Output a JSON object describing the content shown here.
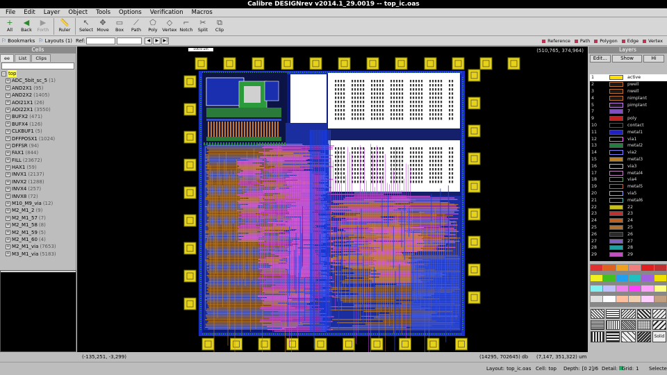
{
  "window": {
    "title": "Calibre DESIGNrev v2014.1_29.0019  --  top_ic.oas"
  },
  "menu": [
    "File",
    "Edit",
    "Layer",
    "Object",
    "Tools",
    "Options",
    "Verification",
    "Macros"
  ],
  "toolbar": [
    {
      "label": "All",
      "icon": "+",
      "name": "all"
    },
    {
      "label": "Back",
      "icon": "◀",
      "name": "back"
    },
    {
      "label": "Forth",
      "icon": "▶",
      "name": "forth",
      "disabled": true
    },
    {
      "label": "Ruler",
      "icon": "📏",
      "name": "ruler"
    },
    {
      "label": "Select",
      "icon": "↖",
      "name": "select"
    },
    {
      "label": "Move",
      "icon": "✥",
      "name": "move"
    },
    {
      "label": "Box",
      "icon": "▭",
      "name": "box"
    },
    {
      "label": "Path",
      "icon": "⟋",
      "name": "path"
    },
    {
      "label": "Poly",
      "icon": "⬠",
      "name": "poly"
    },
    {
      "label": "Vertex",
      "icon": "◇",
      "name": "vertex"
    },
    {
      "label": "Notch",
      "icon": "⌐",
      "name": "notch"
    },
    {
      "label": "Split",
      "icon": "✂",
      "name": "split"
    },
    {
      "label": "Clip",
      "icon": "⧉",
      "name": "clip"
    }
  ],
  "toolbar2": {
    "bookmarks": "Bookmarks",
    "layouts": "Layouts (1)",
    "ref": "Ref:",
    "filters": [
      "Reference",
      "Path",
      "Polygon",
      "Edge",
      "Vertex"
    ]
  },
  "cells": {
    "header": "Cells",
    "tabs": [
      "ee",
      "List",
      "Clips"
    ],
    "items": [
      {
        "name": "top",
        "count": "",
        "top": true
      },
      {
        "name": "ADC_5bit_sc_5",
        "count": "(1)"
      },
      {
        "name": "AND2X1",
        "count": "(95)"
      },
      {
        "name": "AND2X2",
        "count": "(1405)"
      },
      {
        "name": "AOI21X1",
        "count": "(26)"
      },
      {
        "name": "AOI22X1",
        "count": "(3550)"
      },
      {
        "name": "BUFX2",
        "count": "(471)"
      },
      {
        "name": "BUFX4",
        "count": "(126)"
      },
      {
        "name": "CLKBUF1",
        "count": "(5)"
      },
      {
        "name": "DFFPOSX1",
        "count": "(1024)"
      },
      {
        "name": "DFFSR",
        "count": "(94)"
      },
      {
        "name": "FAX1",
        "count": "(844)"
      },
      {
        "name": "FILL",
        "count": "(23672)"
      },
      {
        "name": "HAX1",
        "count": "(59)"
      },
      {
        "name": "INVX1",
        "count": "(2137)"
      },
      {
        "name": "INVX2",
        "count": "(1288)"
      },
      {
        "name": "INVX4",
        "count": "(257)"
      },
      {
        "name": "INVX8",
        "count": "(72)"
      },
      {
        "name": "M10_M9_via",
        "count": "(12)"
      },
      {
        "name": "M2_M1_2",
        "count": "(9)"
      },
      {
        "name": "M2_M1_57",
        "count": "(7)"
      },
      {
        "name": "M2_M1_58",
        "count": "(8)"
      },
      {
        "name": "M2_M1_59",
        "count": "(5)"
      },
      {
        "name": "M2_M1_60",
        "count": "(4)"
      },
      {
        "name": "M2_M1_via",
        "count": "(7653)"
      },
      {
        "name": "M3_M1_via",
        "count": "(5183)"
      }
    ]
  },
  "canvas": {
    "ruler": "100.0 um",
    "coord_tr": "(510,765, 374,964)"
  },
  "status": {
    "cursor": "(-135,251, -3,299)",
    "db": "(14295, 702645) db",
    "um": "(7,147, 351,322) um"
  },
  "bottom": {
    "layout_label": "Layout:",
    "layout": "top_ic.oas",
    "cell_label": "Cell:",
    "cell": "top",
    "depth_label": "Depth:",
    "depth": "[0 2]/6",
    "detail_label": "Detail:",
    "grid_label": "Grid:",
    "grid": "1",
    "selected_label": "Selected"
  },
  "layers": {
    "header": "Layers",
    "buttons": [
      "Edit...",
      "Show",
      "Hi"
    ],
    "items": [
      {
        "num": "1",
        "name": "active",
        "color": "#2a8a2a",
        "sel": true
      },
      {
        "num": "2",
        "name": "pwell",
        "color": "#1a1a1a",
        "border": "#c07030"
      },
      {
        "num": "3",
        "name": "nwell",
        "color": "#1a1a1a",
        "border": "#c07030"
      },
      {
        "num": "4",
        "name": "nimplant",
        "color": "#1a1a1a",
        "border": "#c07030"
      },
      {
        "num": "5",
        "name": "pimplant",
        "color": "#1a1a1a",
        "border": "#c080e0"
      },
      {
        "num": "7",
        "name": "7",
        "color": "#8050c0"
      },
      {
        "num": "9",
        "name": "poly",
        "color": "#c02020"
      },
      {
        "num": "10",
        "name": "contact",
        "color": "#000"
      },
      {
        "num": "11",
        "name": "metal1",
        "color": "#2020c0"
      },
      {
        "num": "12",
        "name": "via1",
        "color": "#000",
        "border": "#ff60ff"
      },
      {
        "num": "13",
        "name": "metal2",
        "color": "#208040"
      },
      {
        "num": "14",
        "name": "via2",
        "color": "#000",
        "border": "#8080ff"
      },
      {
        "num": "15",
        "name": "metal3",
        "color": "#c08020"
      },
      {
        "num": "16",
        "name": "via3",
        "color": "#000",
        "border": "#c0c0c0"
      },
      {
        "num": "17",
        "name": "metal4",
        "color": "#000",
        "border": "#c080c0"
      },
      {
        "num": "18",
        "name": "via4",
        "color": "#000",
        "border": "#60a060"
      },
      {
        "num": "19",
        "name": "metal5",
        "color": "#000",
        "border": "#c06040"
      },
      {
        "num": "20",
        "name": "via5",
        "color": "#000",
        "border": "#a0a0ff"
      },
      {
        "num": "21",
        "name": "metal6",
        "color": "#000",
        "border": "#40c0c0"
      },
      {
        "num": "22",
        "name": "22",
        "color": "#c8c020"
      },
      {
        "num": "23",
        "name": "23",
        "color": "#c03030"
      },
      {
        "num": "24",
        "name": "24",
        "color": "#c06020"
      },
      {
        "num": "25",
        "name": "25",
        "color": "#b07030"
      },
      {
        "num": "26",
        "name": "26",
        "color": "#2a2a2a"
      },
      {
        "num": "27",
        "name": "27",
        "color": "#8060c0"
      },
      {
        "num": "28",
        "name": "28",
        "color": "#20a0a0"
      },
      {
        "num": "29",
        "name": "29",
        "color": "#c050c0"
      }
    ],
    "palette": [
      "#e03030",
      "#e06020",
      "#f0a020",
      "#f08080",
      "#e02020",
      "#c03030",
      "#f0f020",
      "#40c020",
      "#20a0f0",
      "#20c0c0",
      "#a060e0",
      "#f0e000",
      "#80f0f0",
      "#c0c0ff",
      "#f080f0",
      "#ff40ff",
      "#ffa0ff",
      "#ffff80",
      "#e0e0e0",
      "#ffffff",
      "#ffc0a0",
      "#f0d0b0",
      "#ffd0ff",
      "#c0a080"
    ],
    "solid_label": "Solid"
  }
}
